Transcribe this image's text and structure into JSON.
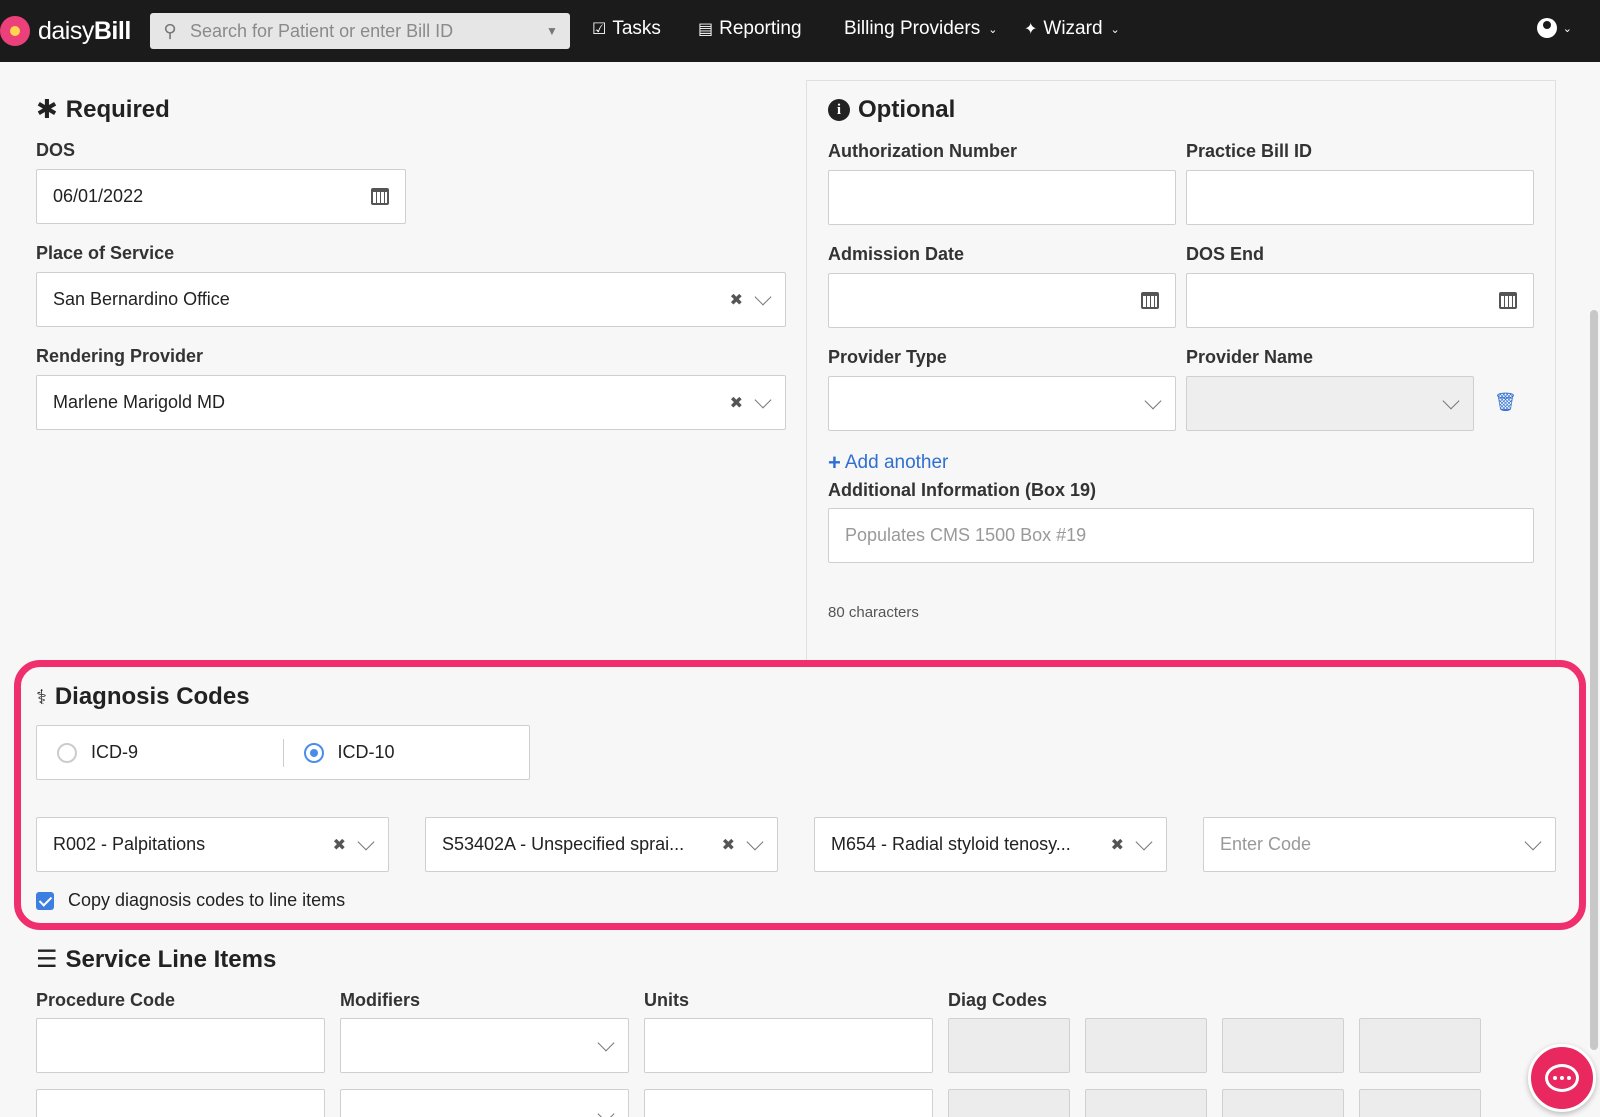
{
  "nav": {
    "brand_light": "daisy",
    "brand_bold": "Bill",
    "search_placeholder": "Search for Patient or enter Bill ID",
    "items": [
      {
        "label": "Tasks",
        "icon": "clipboard-check-icon"
      },
      {
        "label": "Reporting",
        "icon": "bar-chart-icon"
      },
      {
        "label": "Billing Providers",
        "icon": "chevron-down-icon"
      },
      {
        "label": "Wizard",
        "icon": "magic-wand-icon"
      }
    ]
  },
  "required": {
    "title": "Required",
    "dos_label": "DOS",
    "dos_value": "06/01/2022",
    "pos_label": "Place of Service",
    "pos_value": "San Bernardino Office",
    "provider_label": "Rendering Provider",
    "provider_value": "Marlene Marigold MD"
  },
  "optional": {
    "title": "Optional",
    "auth_label": "Authorization Number",
    "practice_bill_label": "Practice Bill ID",
    "admission_label": "Admission Date",
    "dos_end_label": "DOS End",
    "provider_type_label": "Provider Type",
    "provider_name_label": "Provider Name",
    "add_another": "Add another",
    "additional_label": "Additional Information (Box 19)",
    "additional_placeholder": "Populates CMS 1500 Box #19",
    "char_count": "80 characters"
  },
  "diagnosis": {
    "title": "Diagnosis Codes",
    "options": [
      "ICD-9",
      "ICD-10"
    ],
    "selected": "ICD-10",
    "codes": [
      "R002 - Palpitations",
      "S53402A - Unspecified sprai...",
      "M654 - Radial styloid tenosy..."
    ],
    "enter_placeholder": "Enter Code",
    "copy_label": "Copy diagnosis codes to line items",
    "copy_checked": true
  },
  "service_lines": {
    "title": "Service Line Items",
    "columns": [
      "Procedure Code",
      "Modifiers",
      "Units",
      "Diag Codes"
    ]
  },
  "colors": {
    "highlight": "#f0306e",
    "accent": "#2f6fd1",
    "nav_bg": "#1b1b1b"
  }
}
